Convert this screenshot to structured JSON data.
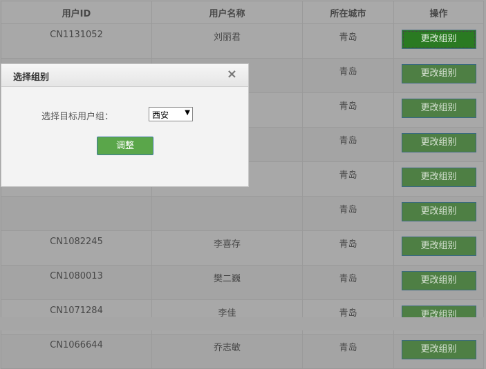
{
  "table": {
    "headers": [
      "用户ID",
      "用户名称",
      "所在城市",
      "操作"
    ],
    "rows": [
      {
        "id": "CN1131052",
        "name": "刘丽君",
        "city": "青岛",
        "action": "更改组别"
      },
      {
        "id": "",
        "name": "",
        "city": "青岛",
        "action": "更改组别"
      },
      {
        "id": "",
        "name": "",
        "city": "青岛",
        "action": "更改组别"
      },
      {
        "id": "",
        "name": "",
        "city": "青岛",
        "action": "更改组别"
      },
      {
        "id": "",
        "name": "",
        "city": "青岛",
        "action": "更改组别"
      },
      {
        "id": "",
        "name": "",
        "city": "青岛",
        "action": "更改组别"
      },
      {
        "id": "CN1082245",
        "name": "李喜存",
        "city": "青岛",
        "action": "更改组别"
      },
      {
        "id": "CN1080013",
        "name": "樊二巍",
        "city": "青岛",
        "action": "更改组别"
      },
      {
        "id": "CN1071284",
        "name": "李佳",
        "city": "青岛",
        "action": "更改组别"
      },
      {
        "id": "CN1066644",
        "name": "乔志敏",
        "city": "青岛",
        "action": "更改组别"
      }
    ]
  },
  "modal": {
    "title": "选择组别",
    "close": "×",
    "label": "选择目标用户组：",
    "selected_group": "西安",
    "submit": "调整"
  }
}
